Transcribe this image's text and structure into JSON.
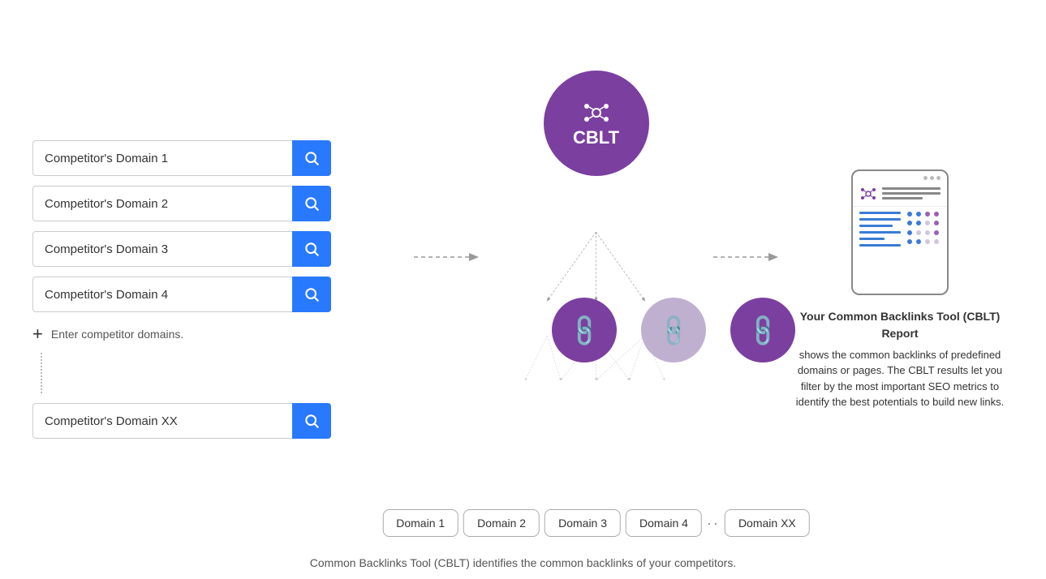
{
  "inputs": [
    {
      "id": "input1",
      "value": "Competitor's Domain 1",
      "placeholder": "Competitor's Domain 1"
    },
    {
      "id": "input2",
      "value": "Competitor's Domain 2",
      "placeholder": "Competitor's Domain 2"
    },
    {
      "id": "input3",
      "value": "Competitor's Domain 3",
      "placeholder": "Competitor's Domain 3"
    },
    {
      "id": "input4",
      "value": "Competitor's Domain 4",
      "placeholder": "Competitor's Domain 4"
    },
    {
      "id": "inputXX",
      "value": "Competitor's Domain XX",
      "placeholder": "Competitor's Domain XX"
    }
  ],
  "add_label": "Enter competitor domains.",
  "cblt_label": "CBLT",
  "domain_boxes": [
    "Domain 1",
    "Domain 2",
    "Domain 3",
    "Domain 4",
    "Domain XX"
  ],
  "report": {
    "title": "Your Common Backlinks Tool (CBLT) Report",
    "description": "shows the common backlinks of predefined domains or pages. The CBLT results let you filter by the most important SEO metrics to identify the best potentials to build new links."
  },
  "caption": "Common Backlinks Tool (CBLT) identifies the common backlinks of your competitors.",
  "colors": {
    "purple": "#7b3fa0",
    "blue": "#2979ff",
    "gray_bubble": "#c0b8cc",
    "dot_blue": "#3a7bd5",
    "dot_purple": "#9c5fb5",
    "dot_gray": "#d0c8da"
  }
}
